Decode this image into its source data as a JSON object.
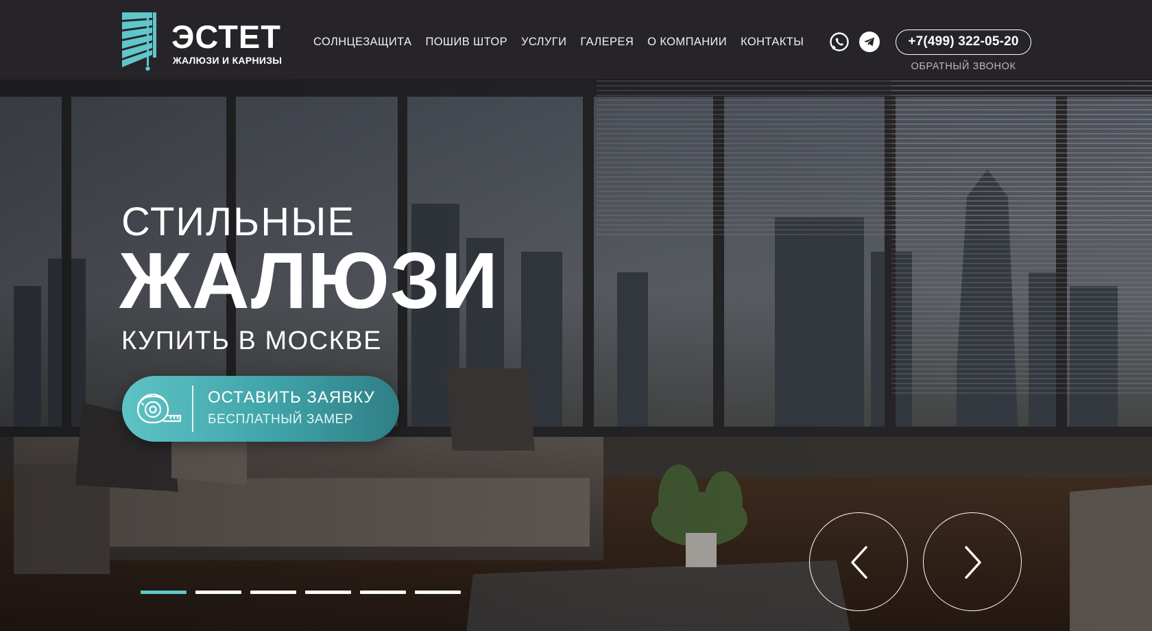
{
  "brand": {
    "name": "ЭСТЕТ",
    "tagline": "ЖАЛЮЗИ И КАРНИЗЫ",
    "accent_color": "#5fc7c9"
  },
  "nav": {
    "items": [
      {
        "label": "СОЛНЦЕЗАЩИТА"
      },
      {
        "label": "ПОШИВ ШТОР"
      },
      {
        "label": "УСЛУГИ"
      },
      {
        "label": "ГАЛЕРЕЯ"
      },
      {
        "label": "О КОМПАНИИ"
      },
      {
        "label": "КОНТАКТЫ"
      }
    ]
  },
  "contacts": {
    "social_icons": [
      "whatsapp-icon",
      "telegram-icon"
    ],
    "phone": "+7(499) 322-05-20",
    "callback_label": "ОБРАТНЫЙ ЗВОНОК"
  },
  "hero": {
    "line1": "СТИЛЬНЫЕ",
    "line2": "ЖАЛЮЗИ",
    "line3": "КУПИТЬ В МОСКВЕ",
    "cta_title": "ОСТАВИТЬ ЗАЯВКУ",
    "cta_subtitle": "БЕСПЛАТНЫЙ ЗАМЕР",
    "cta_icon": "tape-measure-icon"
  },
  "slider": {
    "slide_count": 6,
    "active_slide": 1,
    "prev_icon": "chevron-left-icon",
    "next_icon": "chevron-right-icon"
  }
}
